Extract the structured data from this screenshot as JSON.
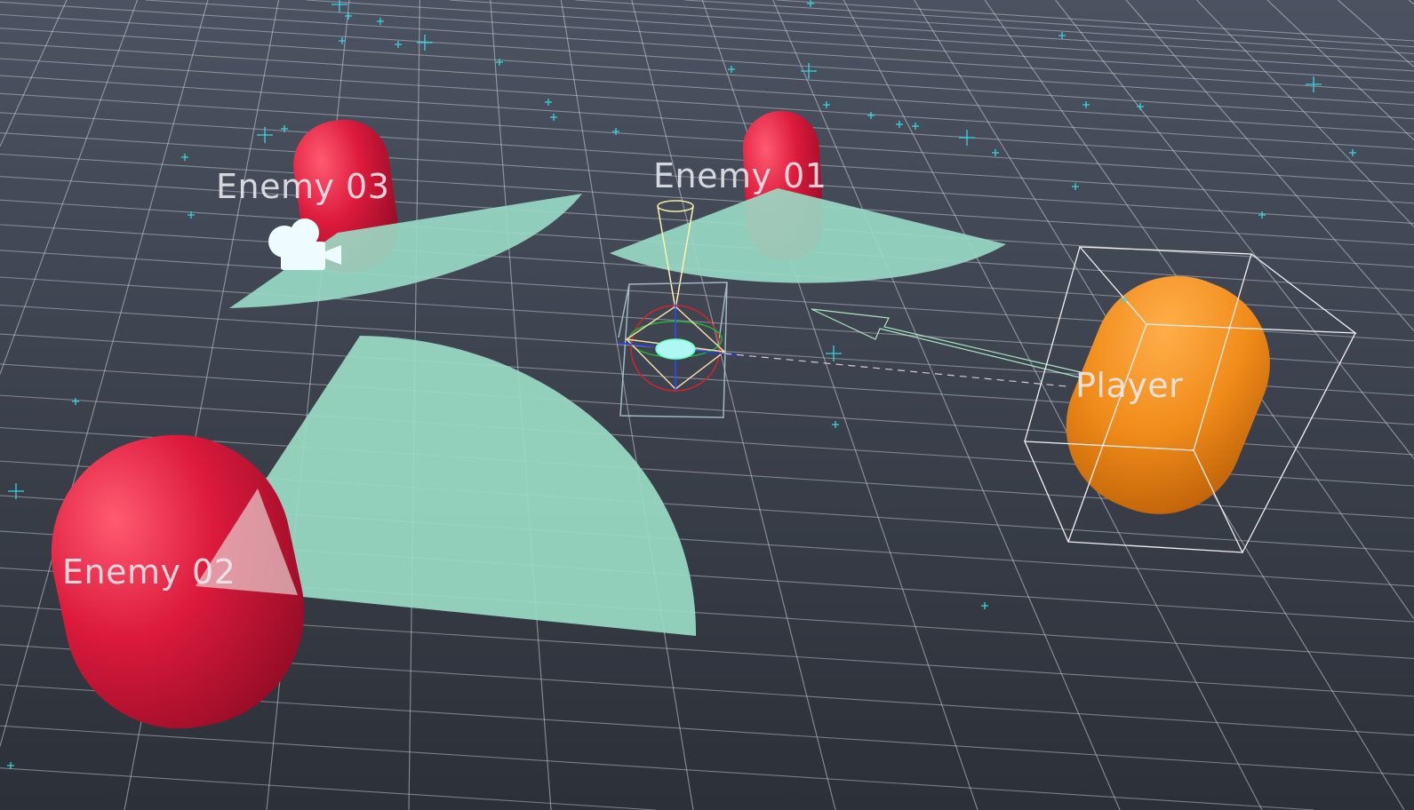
{
  "scene": {
    "labels": {
      "enemy03": "Enemy 03",
      "enemy01": "Enemy 01",
      "enemy02": "Enemy 02",
      "player": "Player"
    },
    "colors": {
      "background_top": "#4b5261",
      "background_bottom": "#2c3038",
      "grid": "#c8ccd4",
      "vision_cone": "#9adcc6",
      "enemy": "#d4173a",
      "player": "#f08c1a",
      "gizmo_star": "#35d6e0"
    },
    "icons": [
      "camera-icon",
      "light-gizmo-icon"
    ]
  }
}
